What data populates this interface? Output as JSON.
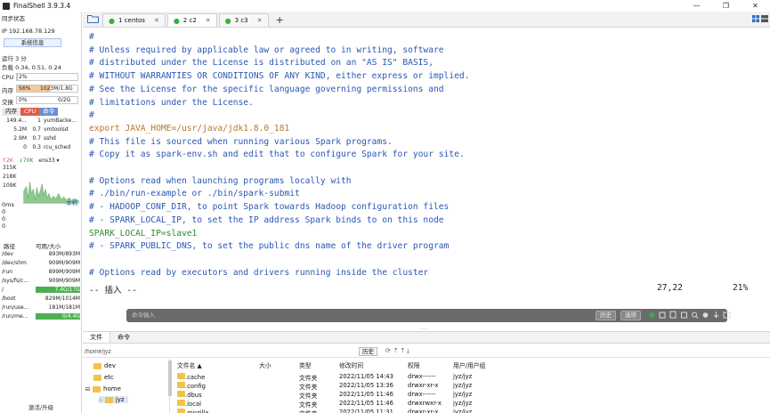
{
  "window": {
    "title": "FinalShell 3.9.3.4",
    "controls": [
      "—",
      "❐",
      "✕"
    ]
  },
  "sidebar": {
    "sync_status": "同步状态",
    "ip": "IP 192.168.78.129",
    "sysinfo_button": "系统信息",
    "uptime": "运行 3 分",
    "load": "负载 0.34, 0.51, 0.24",
    "cpu": {
      "label": "CPU",
      "value": "2%",
      "fraction": 0.02
    },
    "memory": {
      "label": "内存",
      "percent": "56%",
      "detail": "1023M/1.8G",
      "fraction": 0.56
    },
    "swap": {
      "label": "交换",
      "percent": "0%",
      "detail": "0/2G",
      "fraction": 0.0
    },
    "proc_tabs": [
      "内存",
      "CPU",
      "命令"
    ],
    "processes": [
      {
        "mem": "149.4...",
        "cpu": "1",
        "cmd": "yumBacke..."
      },
      {
        "mem": "5.2M",
        "cpu": "0.7",
        "cmd": "vmtoolsd"
      },
      {
        "mem": "2.9M",
        "cpu": "0.7",
        "cmd": "sshd"
      },
      {
        "mem": "0",
        "cpu": "0.3",
        "cmd": "rcu_sched"
      }
    ],
    "net": {
      "up": "↑2K",
      "down": "↓70K",
      "iface": "ens33 ▾",
      "y_labels": [
        "315K",
        "218K",
        "109K"
      ]
    },
    "ping": {
      "label": "0ms",
      "local": "本机",
      "values": [
        "0",
        "0",
        "0"
      ]
    },
    "disk_headers": [
      "路径",
      "可用/大小"
    ],
    "disks": [
      {
        "path": "/dev",
        "size": "893M/893M"
      },
      {
        "path": "/dev/shm",
        "size": "909M/909M"
      },
      {
        "path": "/run",
        "size": "899M/909M"
      },
      {
        "path": "/sys/fs/c...",
        "size": "909M/909M"
      },
      {
        "path": "/",
        "size": "7.4G/17G",
        "highlight": true
      },
      {
        "path": "/boot",
        "size": "829M/1014M"
      },
      {
        "path": "/run/use...",
        "size": "181M/181M"
      },
      {
        "path": "/run/me...",
        "size": "0/4.4G",
        "highlight": true
      }
    ],
    "footer": "激活/升级"
  },
  "tabs": [
    {
      "label": "1 centos",
      "active": false
    },
    {
      "label": "2 c2",
      "active": true
    },
    {
      "label": "3 c3",
      "active": false
    }
  ],
  "terminal": {
    "lines": [
      {
        "text": "#",
        "kind": "comment"
      },
      {
        "text": "# Unless required by applicable law or agreed to in writing, software",
        "kind": "comment"
      },
      {
        "text": "# distributed under the License is distributed on an \"AS IS\" BASIS,",
        "kind": "comment"
      },
      {
        "text": "# WITHOUT WARRANTIES OR CONDITIONS OF ANY KIND, either express or implied.",
        "kind": "comment"
      },
      {
        "text": "# See the License for the specific language governing permissions and",
        "kind": "comment"
      },
      {
        "text": "# limitations under the License.",
        "kind": "comment"
      },
      {
        "text": "#",
        "kind": "comment"
      },
      {
        "text": "export JAVA_HOME=/usr/java/jdk1.8.0_181",
        "kind": "export"
      },
      {
        "text": "# This file is sourced when running various Spark programs.",
        "kind": "comment"
      },
      {
        "text": "# Copy it as spark-env.sh and edit that to configure Spark for your site.",
        "kind": "comment"
      },
      {
        "text": "",
        "kind": "comment"
      },
      {
        "text": "# Options read when launching programs locally with",
        "kind": "comment"
      },
      {
        "text": "# ./bin/run-example or ./bin/spark-submit",
        "kind": "comment"
      },
      {
        "text": "# - HADOOP_CONF_DIR, to point Spark towards Hadoop configuration files",
        "kind": "comment"
      },
      {
        "text": "# - SPARK_LOCAL_IP, to set the IP address Spark binds to on this node",
        "kind": "comment"
      },
      {
        "text": "SPARK_LOCAL_IP=slave1",
        "kind": "var"
      },
      {
        "text": "# - SPARK_PUBLIC_DNS, to set the public dns name of the driver program",
        "kind": "comment"
      },
      {
        "text": "",
        "kind": "comment"
      },
      {
        "text": "# Options read by executors and drivers running inside the cluster",
        "kind": "comment"
      }
    ],
    "mode": "-- 插入 --",
    "position": "27,22",
    "percent": "21%"
  },
  "cmdbar": {
    "placeholder": "命令输入",
    "history": "历史",
    "options": "选项"
  },
  "bottom": {
    "tabs": [
      "文件",
      "命令"
    ],
    "path": "/home/jyz",
    "history": "历史",
    "tree": [
      {
        "name": "dev"
      },
      {
        "name": "etc"
      },
      {
        "name": "home"
      },
      {
        "name": "jyz"
      }
    ],
    "headers": [
      "文件名 ▲",
      "大小",
      "类型",
      "修改时间",
      "权限",
      "用户/用户组"
    ],
    "files": [
      {
        "name": ".cache",
        "size": "",
        "type": "文件夹",
        "date": "2022/11/05 14:43",
        "perm": "drwx------",
        "owner": "jyz/jyz"
      },
      {
        "name": ".config",
        "size": "",
        "type": "文件夹",
        "date": "2022/11/05 13:36",
        "perm": "drwxr-xr-x",
        "owner": "jyz/jyz"
      },
      {
        "name": ".dbus",
        "size": "",
        "type": "文件夹",
        "date": "2022/11/05 11:46",
        "perm": "drwx------",
        "owner": "jyz/jyz"
      },
      {
        "name": ".local",
        "size": "",
        "type": "文件夹",
        "date": "2022/11/05 11:46",
        "perm": "drwxrwxr-x",
        "owner": "jyz/jyz"
      },
      {
        "name": ".mozilla",
        "size": "",
        "type": "文件夹",
        "date": "2022/11/05 11:31",
        "perm": "drwxr-xr-x",
        "owner": "jyz/jyz"
      }
    ]
  },
  "colors": {
    "comment": "#2a57b4",
    "export": "#b8762c",
    "var": "#2d8c2d",
    "accent": "#3cae3c"
  }
}
